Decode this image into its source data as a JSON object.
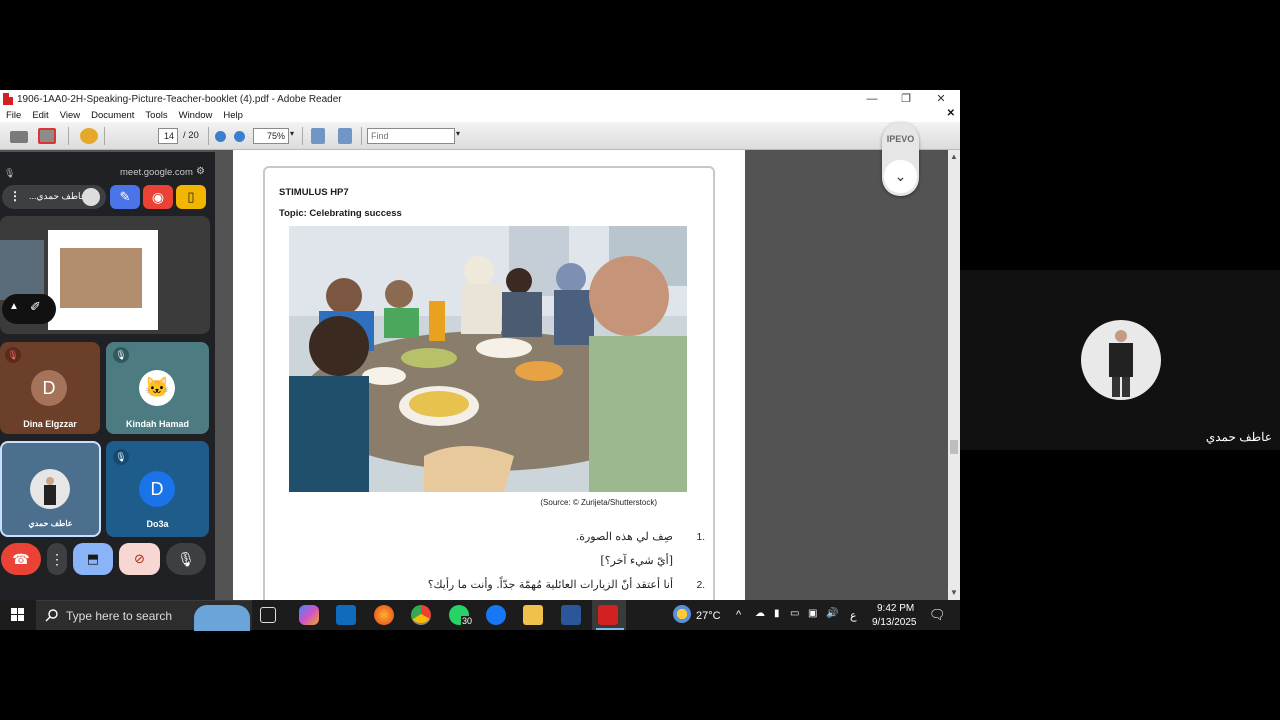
{
  "window": {
    "title": "1906-1AA0-2H-Speaking-Picture-Teacher-booklet (4).pdf - Adobe Reader",
    "minimize": "—",
    "restore": "❐",
    "close": "✕",
    "menu_close": "✕"
  },
  "menu": [
    "File",
    "Edit",
    "View",
    "Document",
    "Tools",
    "Window",
    "Help"
  ],
  "toolbar": {
    "page_current": "14",
    "page_total": "/ 20",
    "zoom": "75%",
    "find_placeholder": "Find"
  },
  "document": {
    "stimulus_title": "STIMULUS HP7",
    "topic": "Topic: Celebrating success",
    "source": "(Source: © Zurijeta/Shutterstock)",
    "q1_num": "1.",
    "q1_text": "صِف لي هذه الصورة.",
    "q1_followup": "[أيّ شيء آخر؟]",
    "q2_num": "2.",
    "q2_text": "أنا أعتقد أنّ الزيارات العائلية مُهمّة جدّاً. وأنت ما رأيك؟"
  },
  "ipevo": {
    "label": "IPEVO",
    "toggle_icon": "chevron-down-icon"
  },
  "meet": {
    "url": "meet.google.com",
    "presenter_name": "عاطف حمدي...",
    "participants": [
      {
        "initial": "D",
        "name": "Dina Elgzzar",
        "bg": "#6b3f2a",
        "avatar_bg": "#a5725a"
      },
      {
        "initial": "",
        "name": "Kindah Hamad",
        "bg": "#4c7b82",
        "avatar_bg": "#ffffff"
      },
      {
        "initial": "",
        "name": "عاطف حمدي",
        "bg": "#4d6f8e",
        "avatar_bg": "#e6e6e6"
      },
      {
        "initial": "D",
        "name": "Do3a",
        "bg": "#1e5c8c",
        "avatar_bg": "#1a73e8"
      }
    ]
  },
  "right_panel": {
    "name": "عاطف حمدي"
  },
  "taskbar": {
    "search_placeholder": "Type here to search",
    "whatsapp_badge": "30",
    "temperature": "27°C",
    "ime": "ع",
    "time": "9:42 PM",
    "date": "9/13/2025"
  },
  "colors": {
    "reader_red": "#d32020",
    "meet_bg": "#202124",
    "meet_blue": "#8ab4f8",
    "meet_red": "#ea4335",
    "taskbar_bg": "#1c1c1c"
  }
}
